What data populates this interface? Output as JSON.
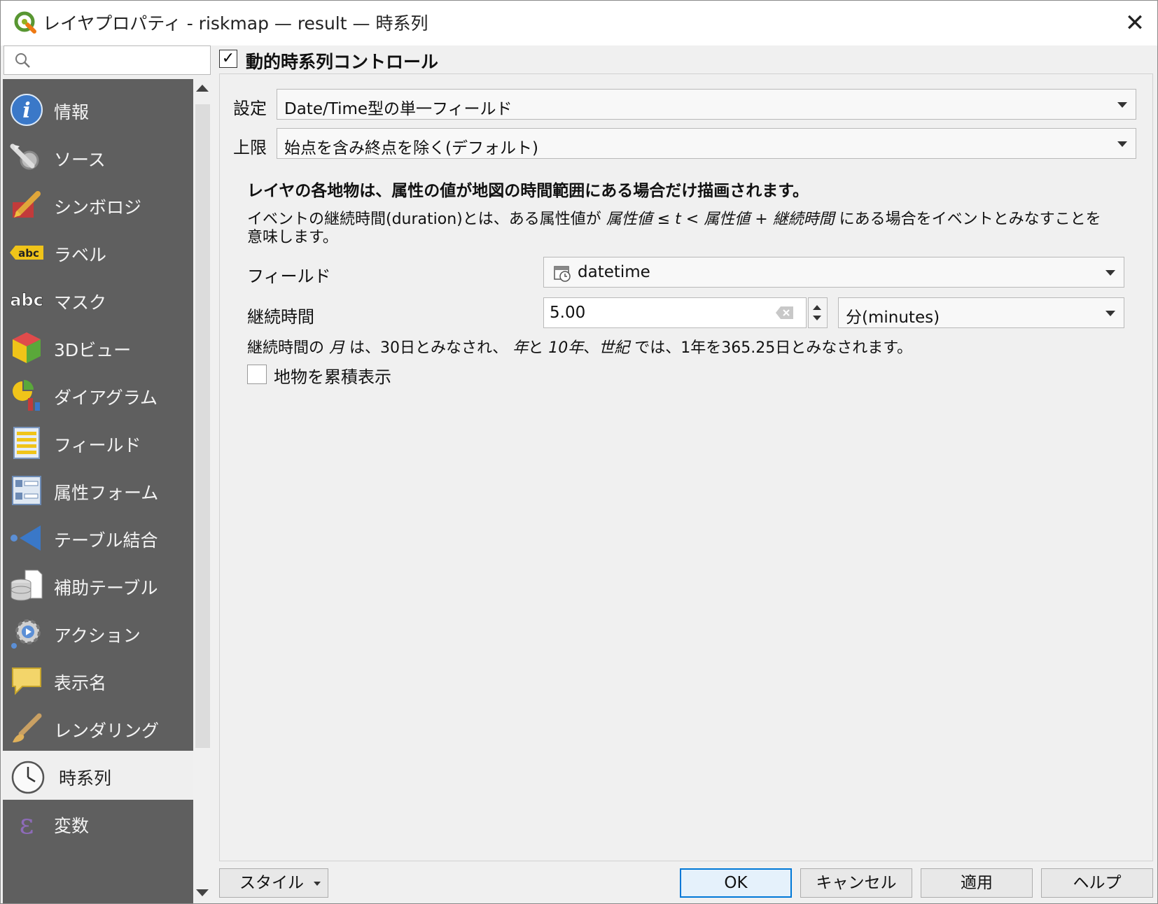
{
  "window": {
    "title": "レイヤプロパティ - riskmap — result — 時系列",
    "close_glyph": "✕"
  },
  "sidebar": {
    "search_placeholder": "",
    "items": [
      {
        "label": "情報",
        "icon": "info-icon"
      },
      {
        "label": "ソース",
        "icon": "source-wrench-icon"
      },
      {
        "label": "シンボロジ",
        "icon": "symbology-paintbrush-icon"
      },
      {
        "label": "ラベル",
        "icon": "label-abc-icon"
      },
      {
        "label": "マスク",
        "icon": "mask-abc-icon"
      },
      {
        "label": "3Dビュー",
        "icon": "3d-cube-icon"
      },
      {
        "label": "ダイアグラム",
        "icon": "diagram-icon"
      },
      {
        "label": "フィールド",
        "icon": "fields-icon"
      },
      {
        "label": "属性フォーム",
        "icon": "attribute-form-icon"
      },
      {
        "label": "テーブル結合",
        "icon": "table-join-icon"
      },
      {
        "label": "補助テーブル",
        "icon": "auxiliary-storage-icon"
      },
      {
        "label": "アクション",
        "icon": "action-gear-icon"
      },
      {
        "label": "表示名",
        "icon": "display-name-bubble-icon"
      },
      {
        "label": "レンダリング",
        "icon": "rendering-brush-icon"
      },
      {
        "label": "時系列",
        "icon": "clock-icon",
        "active": true
      },
      {
        "label": "変数",
        "icon": "variable-epsilon-icon"
      }
    ]
  },
  "temporal": {
    "dynamic_control_label": "動的時系列コントロール",
    "dynamic_control_checked": true,
    "configuration_label": "設定",
    "configuration_value": "Date/Time型の単一フィールド",
    "limits_label": "上限",
    "limits_value": "始点を含み終点を除く(デフォルト)",
    "description_bold": "レイヤの各地物は、属性の値が地図の時間範囲にある場合だけ描画されます。",
    "description_part1": "イベントの継続時間(duration)とは、ある属性値が ",
    "description_italic1": "属性値 ≤ t < 属性値 + 継続時間",
    "description_part2": " にある場合をイベントとみなすことを意味します。",
    "field_label": "フィールド",
    "field_value": "datetime",
    "duration_label": "継続時間",
    "duration_value": "5.00",
    "duration_unit": "分(minutes)",
    "note_part1": "継続時間の ",
    "note_italic1": "月",
    "note_part2": " は、30日とみなされ、 ",
    "note_italic2": "年",
    "note_part3": "と ",
    "note_italic3": "10年",
    "note_part4": "、",
    "note_italic4": "世紀",
    "note_part5": " では、1年を365.25日とみなされます。",
    "accumulate_label": "地物を累積表示",
    "accumulate_checked": false
  },
  "buttons": {
    "style": "スタイル",
    "ok": "OK",
    "cancel": "キャンセル",
    "apply": "適用",
    "help": "ヘルプ"
  },
  "colors": {
    "sidebar_bg": "#5f5f5f",
    "active_item_bg": "#efefef",
    "primary_button_border": "#0078d7"
  }
}
